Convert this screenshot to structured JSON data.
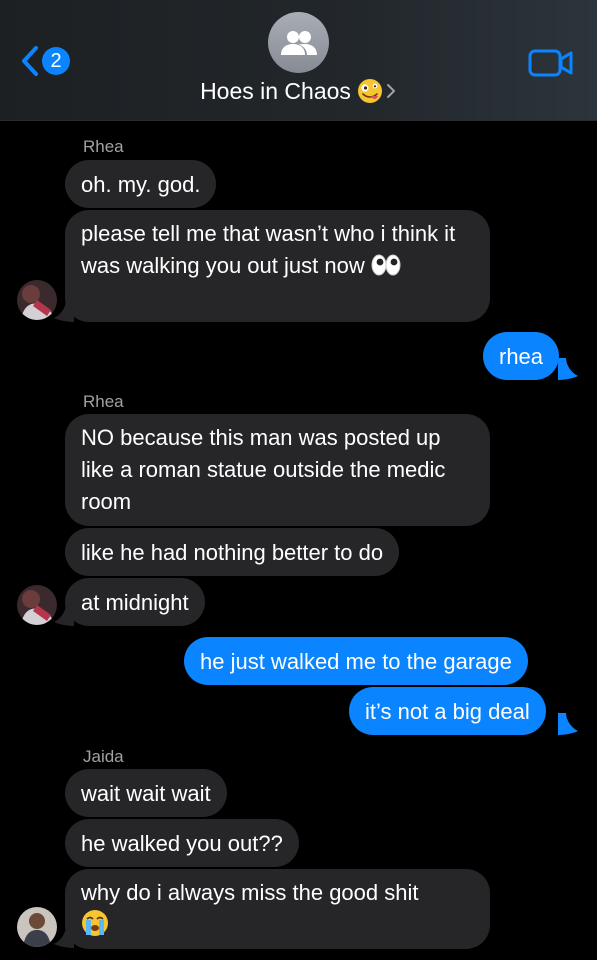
{
  "header": {
    "back_badge": "2",
    "title": "Hoes in Chaos"
  },
  "colors": {
    "accent": "#0a84ff",
    "incoming_bubble": "#262628",
    "outgoing_bubble": "#0a84ff",
    "sender_name": "#a1a1a6"
  },
  "messages": [
    {
      "sender": "Rhea",
      "text": "oh. my. god."
    },
    {
      "text": "please tell me that wasn’t who i think it was walking you out just now",
      "emoji": "eyes"
    },
    {
      "text": "rhea",
      "outgoing": true
    },
    {
      "sender": "Rhea",
      "text": "NO because this man was posted up like a roman statue outside the medic room"
    },
    {
      "text": "like he had nothing better to do"
    },
    {
      "text": "at midnight"
    },
    {
      "text": "he just walked me to the garage",
      "outgoing": true
    },
    {
      "text": "it’s not a big deal",
      "outgoing": true
    },
    {
      "sender": "Jaida",
      "text": "wait wait wait"
    },
    {
      "text": "he walked you out??"
    },
    {
      "text": "why do i always miss the good shit",
      "emoji": "crying"
    }
  ]
}
